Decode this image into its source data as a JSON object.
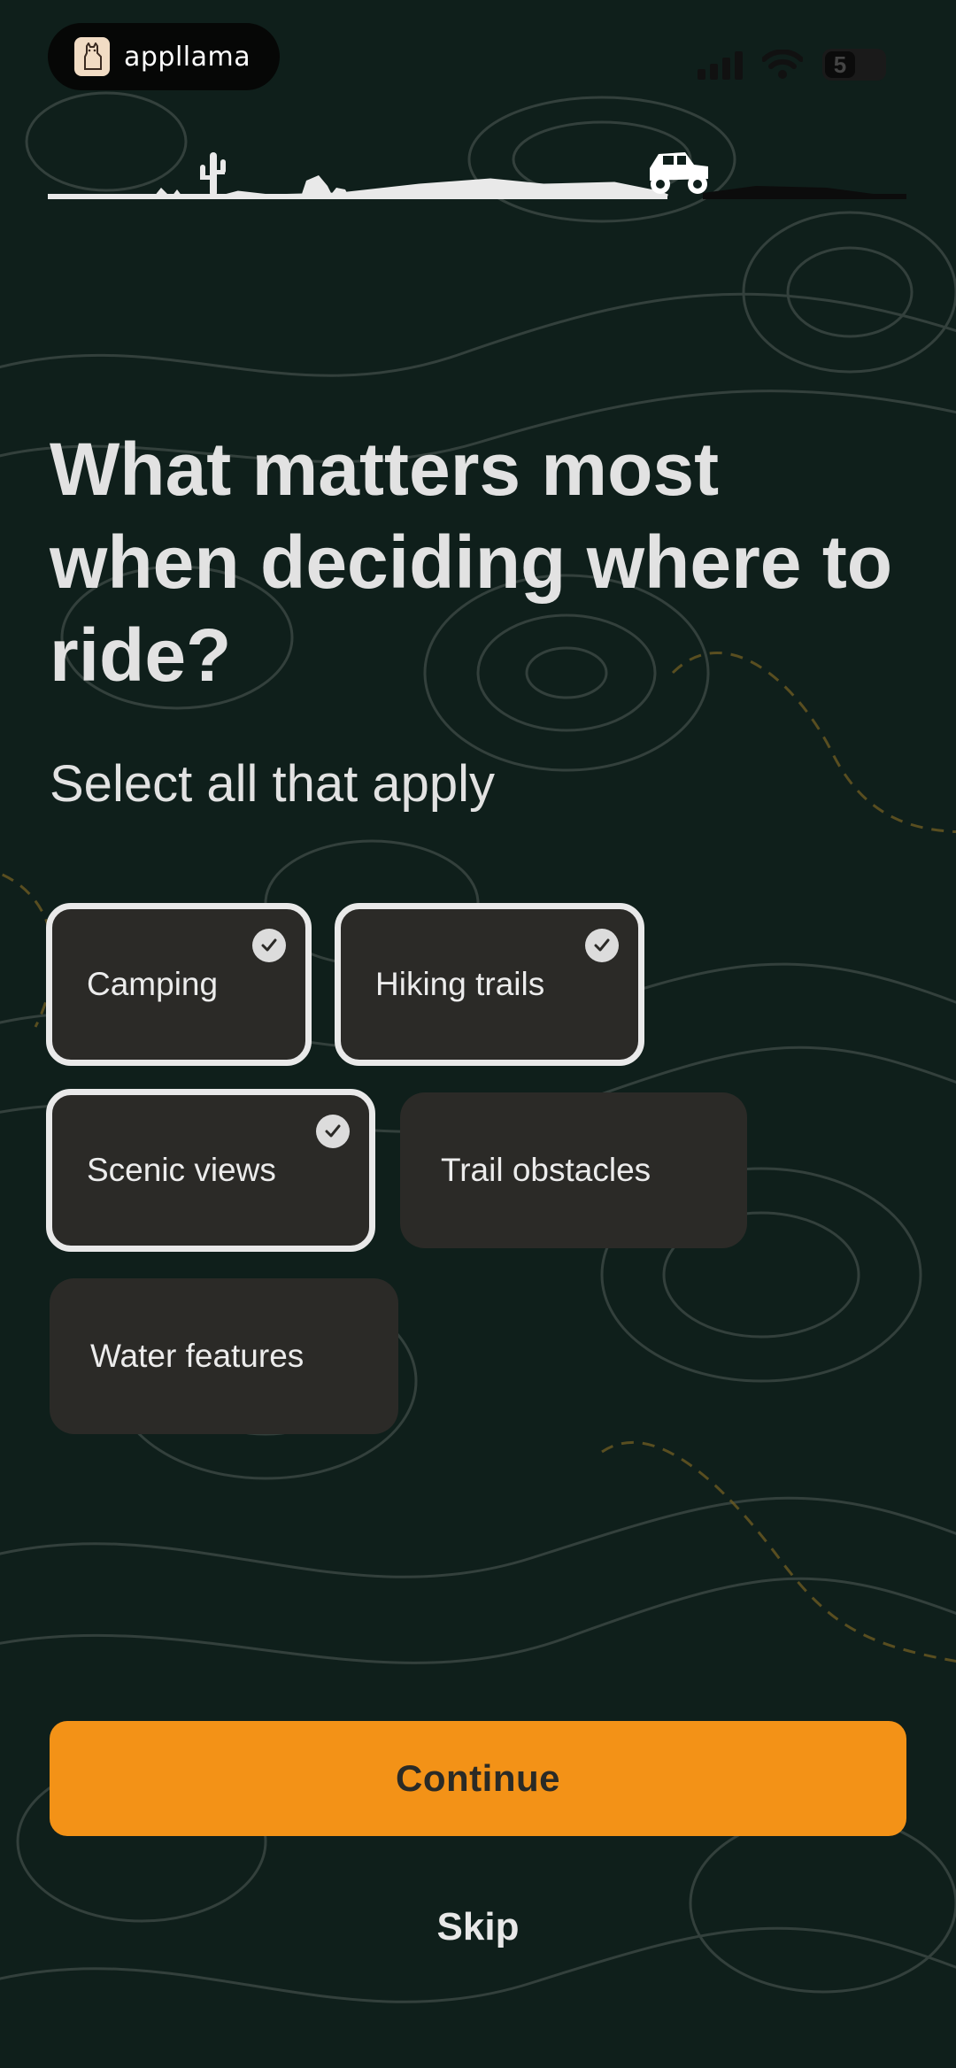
{
  "status_bar": {
    "brand_name": "appllama",
    "battery_level": "5",
    "logo_icon": "llama-icon",
    "signal_icon": "cellular-signal-icon",
    "wifi_icon": "wifi-icon",
    "battery_icon": "battery-icon"
  },
  "progress": {
    "scene_icon": "trail-progress-with-offroad-vehicle",
    "fraction_complete": 0.7
  },
  "question": {
    "title": "What matters most when deciding where to ride?",
    "subtitle": "Select all that apply"
  },
  "options": [
    {
      "label": "Camping",
      "selected": true
    },
    {
      "label": "Hiking trails",
      "selected": true
    },
    {
      "label": "Scenic views",
      "selected": true
    },
    {
      "label": "Trail obstacles",
      "selected": false
    },
    {
      "label": "Water features",
      "selected": false
    }
  ],
  "actions": {
    "continue_label": "Continue",
    "skip_label": "Skip"
  },
  "colors": {
    "background": "#0f1f1b",
    "accent": "#f39217",
    "chip": "#2b2a27",
    "selected_border": "#e9e9e9"
  }
}
